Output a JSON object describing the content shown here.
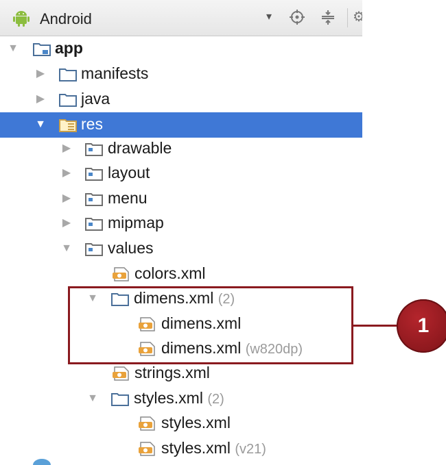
{
  "toolbar": {
    "title": "Android",
    "dropdown": "▾"
  },
  "tree": [
    {
      "label": "app",
      "arrow": "▼",
      "icon": "module-folder-icon",
      "bold": true
    },
    {
      "label": "manifests",
      "arrow": "▶",
      "icon": "folder-icon"
    },
    {
      "label": "java",
      "arrow": "▶",
      "icon": "folder-icon"
    },
    {
      "label": "res",
      "arrow": "▼",
      "icon": "res-folder-icon",
      "selected": true
    },
    {
      "label": "drawable",
      "arrow": "▶",
      "icon": "res-subfolder-icon"
    },
    {
      "label": "layout",
      "arrow": "▶",
      "icon": "res-subfolder-icon"
    },
    {
      "label": "menu",
      "arrow": "▶",
      "icon": "res-subfolder-icon"
    },
    {
      "label": "mipmap",
      "arrow": "▶",
      "icon": "res-subfolder-icon"
    },
    {
      "label": "values",
      "arrow": "▼",
      "icon": "res-subfolder-icon"
    },
    {
      "label": "colors.xml",
      "icon": "xml-file-icon"
    },
    {
      "label": "dimens.xml",
      "suffix": "(2)",
      "arrow": "▼",
      "icon": "folder-icon"
    },
    {
      "label": "dimens.xml",
      "icon": "xml-file-icon"
    },
    {
      "label": "dimens.xml",
      "suffix": "(w820dp)",
      "icon": "xml-file-icon"
    },
    {
      "label": "strings.xml",
      "icon": "xml-file-icon"
    },
    {
      "label": "styles.xml",
      "suffix": "(2)",
      "arrow": "▼",
      "icon": "folder-icon"
    },
    {
      "label": "styles.xml",
      "icon": "xml-file-icon"
    },
    {
      "label": "styles.xml",
      "suffix": "(v21)",
      "icon": "xml-file-icon"
    }
  ],
  "callout": {
    "number": "1"
  },
  "colors": {
    "selection": "#3f78d6",
    "callout": "#8a1a1f"
  }
}
